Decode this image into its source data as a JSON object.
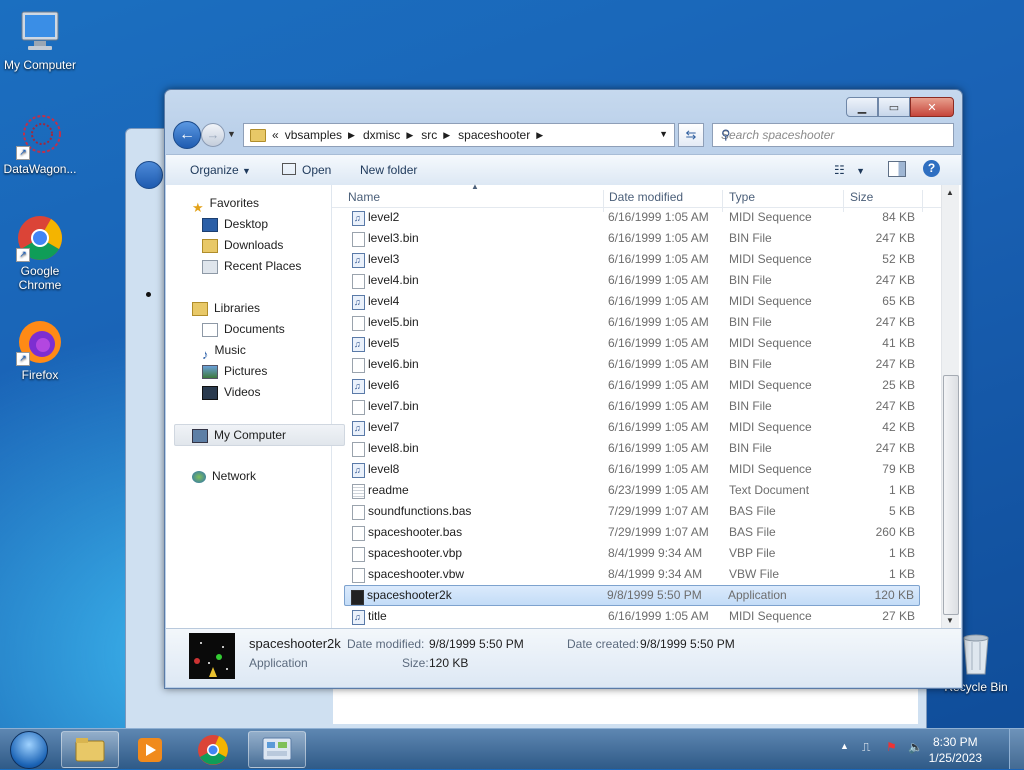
{
  "desktop": {
    "icons": [
      {
        "label": "My Computer"
      },
      {
        "label": "DataWagon..."
      },
      {
        "label": "Google Chrome"
      },
      {
        "label": "Firefox"
      },
      {
        "label": "Recycle Bin"
      }
    ]
  },
  "window": {
    "breadcrumb": {
      "overflow": "«",
      "segments": [
        "vbsamples",
        "dxmisc",
        "src",
        "spaceshooter"
      ]
    },
    "search_placeholder": "Search spaceshooter",
    "toolbar": {
      "organize": "Organize",
      "open": "Open",
      "new_folder": "New folder"
    },
    "nav_pane": {
      "favorites": {
        "label": "Favorites",
        "items": [
          "Desktop",
          "Downloads",
          "Recent Places"
        ]
      },
      "libraries": {
        "label": "Libraries",
        "items": [
          "Documents",
          "Music",
          "Pictures",
          "Videos"
        ]
      },
      "computer": "My Computer",
      "network": "Network"
    },
    "columns": {
      "name": "Name",
      "date": "Date modified",
      "type": "Type",
      "size": "Size"
    },
    "files": [
      {
        "name": "level2",
        "date": "6/16/1999 1:05 AM",
        "type": "MIDI Sequence",
        "size": "84 KB",
        "icon": "midi"
      },
      {
        "name": "level3.bin",
        "date": "6/16/1999 1:05 AM",
        "type": "BIN File",
        "size": "247 KB",
        "icon": "file"
      },
      {
        "name": "level3",
        "date": "6/16/1999 1:05 AM",
        "type": "MIDI Sequence",
        "size": "52 KB",
        "icon": "midi"
      },
      {
        "name": "level4.bin",
        "date": "6/16/1999 1:05 AM",
        "type": "BIN File",
        "size": "247 KB",
        "icon": "file"
      },
      {
        "name": "level4",
        "date": "6/16/1999 1:05 AM",
        "type": "MIDI Sequence",
        "size": "65 KB",
        "icon": "midi"
      },
      {
        "name": "level5.bin",
        "date": "6/16/1999 1:05 AM",
        "type": "BIN File",
        "size": "247 KB",
        "icon": "file"
      },
      {
        "name": "level5",
        "date": "6/16/1999 1:05 AM",
        "type": "MIDI Sequence",
        "size": "41 KB",
        "icon": "midi"
      },
      {
        "name": "level6.bin",
        "date": "6/16/1999 1:05 AM",
        "type": "BIN File",
        "size": "247 KB",
        "icon": "file"
      },
      {
        "name": "level6",
        "date": "6/16/1999 1:05 AM",
        "type": "MIDI Sequence",
        "size": "25 KB",
        "icon": "midi"
      },
      {
        "name": "level7.bin",
        "date": "6/16/1999 1:05 AM",
        "type": "BIN File",
        "size": "247 KB",
        "icon": "file"
      },
      {
        "name": "level7",
        "date": "6/16/1999 1:05 AM",
        "type": "MIDI Sequence",
        "size": "42 KB",
        "icon": "midi"
      },
      {
        "name": "level8.bin",
        "date": "6/16/1999 1:05 AM",
        "type": "BIN File",
        "size": "247 KB",
        "icon": "file"
      },
      {
        "name": "level8",
        "date": "6/16/1999 1:05 AM",
        "type": "MIDI Sequence",
        "size": "79 KB",
        "icon": "midi"
      },
      {
        "name": "readme",
        "date": "6/23/1999 1:05 AM",
        "type": "Text Document",
        "size": "1 KB",
        "icon": "txt"
      },
      {
        "name": "soundfunctions.bas",
        "date": "7/29/1999 1:07 AM",
        "type": "BAS File",
        "size": "5 KB",
        "icon": "file"
      },
      {
        "name": "spaceshooter.bas",
        "date": "7/29/1999 1:07 AM",
        "type": "BAS File",
        "size": "260 KB",
        "icon": "file"
      },
      {
        "name": "spaceshooter.vbp",
        "date": "8/4/1999 9:34 AM",
        "type": "VBP File",
        "size": "1 KB",
        "icon": "file"
      },
      {
        "name": "spaceshooter.vbw",
        "date": "8/4/1999 9:34 AM",
        "type": "VBW File",
        "size": "1 KB",
        "icon": "file"
      },
      {
        "name": "spaceshooter2k",
        "date": "9/8/1999 5:50 PM",
        "type": "Application",
        "size": "120 KB",
        "icon": "app",
        "selected": true
      },
      {
        "name": "title",
        "date": "6/16/1999 1:05 AM",
        "type": "MIDI Sequence",
        "size": "27 KB",
        "icon": "midi"
      }
    ],
    "details": {
      "name": "spaceshooter2k",
      "type": "Application",
      "date_modified_label": "Date modified:",
      "date_modified": "9/8/1999 5:50 PM",
      "date_created_label": "Date created:",
      "date_created": "9/8/1999 5:50 PM",
      "size_label": "Size:",
      "size": "120 KB"
    }
  },
  "taskbar": {
    "time": "8:30 PM",
    "date": "1/25/2023"
  }
}
